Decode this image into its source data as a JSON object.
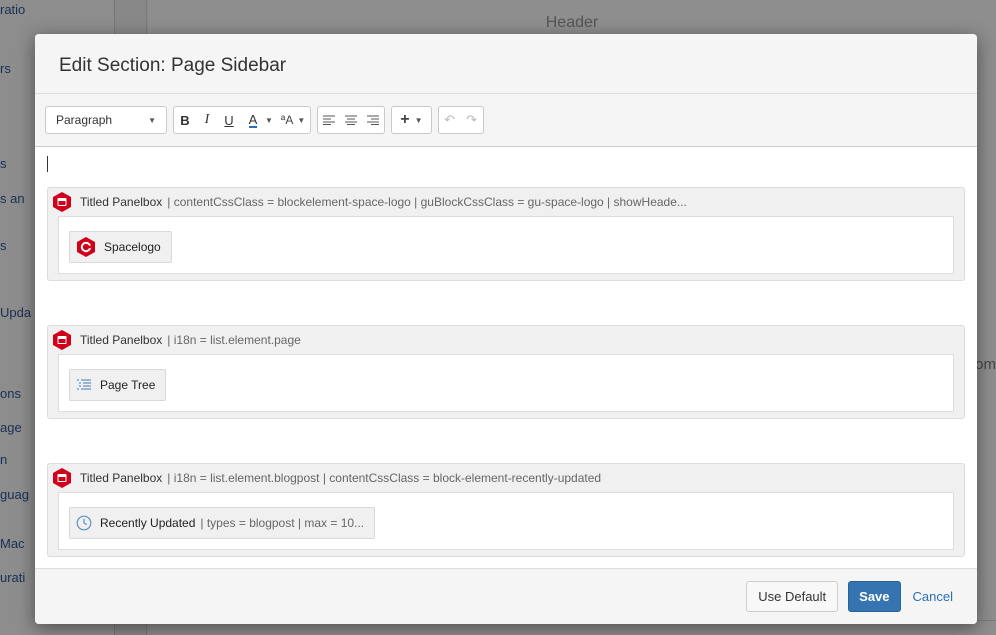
{
  "background": {
    "header": "Header",
    "left_items": [
      "ratio",
      "rs",
      "s",
      "s an",
      "s",
      "Upda",
      "ons",
      "age",
      "n",
      "guag",
      "Mac",
      "urati"
    ],
    "right_fragment": "om"
  },
  "dialog": {
    "title": "Edit Section: Page Sidebar"
  },
  "toolbar": {
    "paragraph_select": "Paragraph",
    "bold": "B",
    "italic": "I",
    "underline": "U",
    "text_color": "A",
    "more_format": "ªA"
  },
  "panels": [
    {
      "title": "Titled Panelbox",
      "params": "| contentCssClass = blockelement-space-logo | guBlockCssClass = gu-space-logo | showHeade...",
      "chip_label": "Spacelogo",
      "chip_params": "",
      "chip_icon": "space-logo-icon"
    },
    {
      "title": "Titled Panelbox",
      "params": "| i18n = list.element.page",
      "chip_label": "Page Tree",
      "chip_params": "",
      "chip_icon": "page-tree-icon"
    },
    {
      "title": "Titled Panelbox",
      "params": "| i18n = list.element.blogpost | contentCssClass = block-element-recently-updated",
      "chip_label": "Recently Updated",
      "chip_params": "| types = blogpost | max = 10...",
      "chip_icon": "clock-icon"
    }
  ],
  "footer": {
    "use_default": "Use Default",
    "save": "Save",
    "cancel": "Cancel"
  },
  "colors": {
    "primary": "#3573b1",
    "link": "#2a6ebb",
    "macro_red": "#d0021b"
  }
}
